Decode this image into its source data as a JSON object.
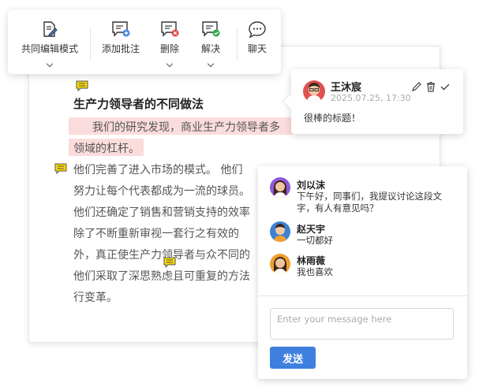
{
  "toolbar": {
    "co_edit_label": "共同编辑模式",
    "add_comment_label": "添加批注",
    "delete_label": "删除",
    "resolve_label": "解决",
    "chat_label": "聊天"
  },
  "document": {
    "title": "生产力领导者的不同做法",
    "lines": [
      "我们的研究发现，商业生产力领导者多",
      "领域的杠杆。",
      "他们完善了进入市场的模式。 他们",
      "努力让每个代表都成为一流的球员。",
      "他们还确定了销售和营销支持的效率",
      "除了不断重新审视一套行之有效的",
      "外，真正使生产力领导者与众不同的",
      "他们采取了深思熟虑且可重复的方法",
      "行变革。"
    ]
  },
  "comment_popup": {
    "author": "王沐宸",
    "time": "2025.07.25, 17:30",
    "text": "很棒的标题！"
  },
  "chat": {
    "messages": [
      {
        "name": "刘以沫",
        "text": "下午好，同事们，我提议讨论这段文字，有人有意见吗？"
      },
      {
        "name": "赵天宇",
        "text": "一切都好"
      },
      {
        "name": "林雨薇",
        "text": "我也喜欢"
      }
    ],
    "input_placeholder": "Enter your message here",
    "send_label": "发送"
  },
  "colors": {
    "accent": "#3f7fe0",
    "highlight": "#fbdcdc",
    "comment_icon": "#f5d800",
    "delete_badge": "#e04848",
    "resolve_badge": "#2ea84a"
  }
}
